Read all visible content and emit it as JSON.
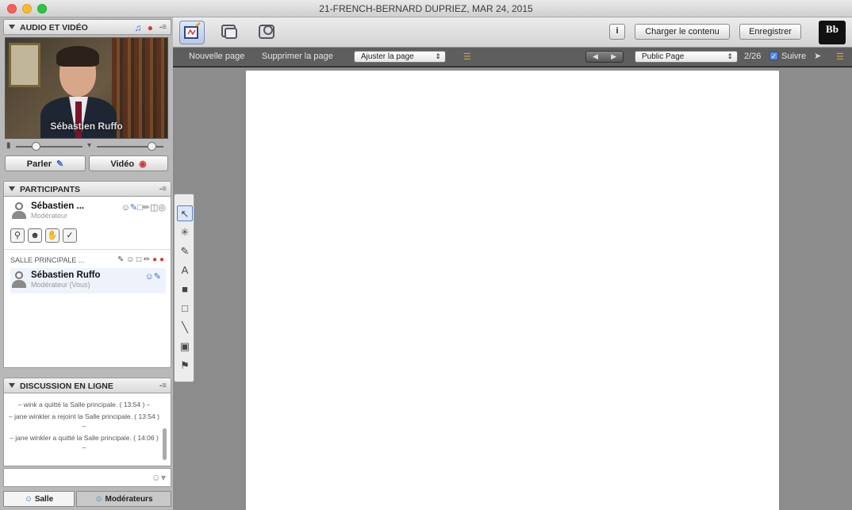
{
  "window": {
    "title": "21-FRENCH-BERNARD DUPRIEZ, MAR 24, 2015"
  },
  "audio_video": {
    "header": "AUDIO ET VIDÉO",
    "video_caption": "Sébastien Ruffo",
    "talk_button": "Parler",
    "video_button": "Vidéo"
  },
  "participants": {
    "header": "PARTICIPANTS",
    "moderator": {
      "name": "Sébastien ...",
      "role": "Modérateur"
    },
    "room_label": "SALLE PRINCIPALE ...",
    "members": [
      {
        "name": "Sébastien Ruffo",
        "role": "Modérateur (Vous)"
      }
    ]
  },
  "chat": {
    "header": "DISCUSSION EN LIGNE",
    "messages": [
      "– wink a quitté la Salle principale. ( 13:54 ) –",
      "– jane winkler a rejoint la Salle principale. ( 13:54 ) –",
      "– jane winkler a quitté la Salle principale. ( 14:06 ) –"
    ],
    "tabs": [
      "Salle",
      "Modérateurs"
    ]
  },
  "toolbar": {
    "load_button": "Charger le contenu",
    "record_button": "Enregistrer",
    "info_icon": "i",
    "logo": "Bb"
  },
  "subbar": {
    "new_page": "Nouvelle page",
    "delete_page": "Supprimer la page",
    "fit_select": "Ajuster la page",
    "page_select": "Public Page",
    "page_count": "2/26",
    "follow_label": "Suivre"
  },
  "colors": {
    "accent_blue": "#3a6ad0",
    "record_red": "#d43a3a"
  }
}
